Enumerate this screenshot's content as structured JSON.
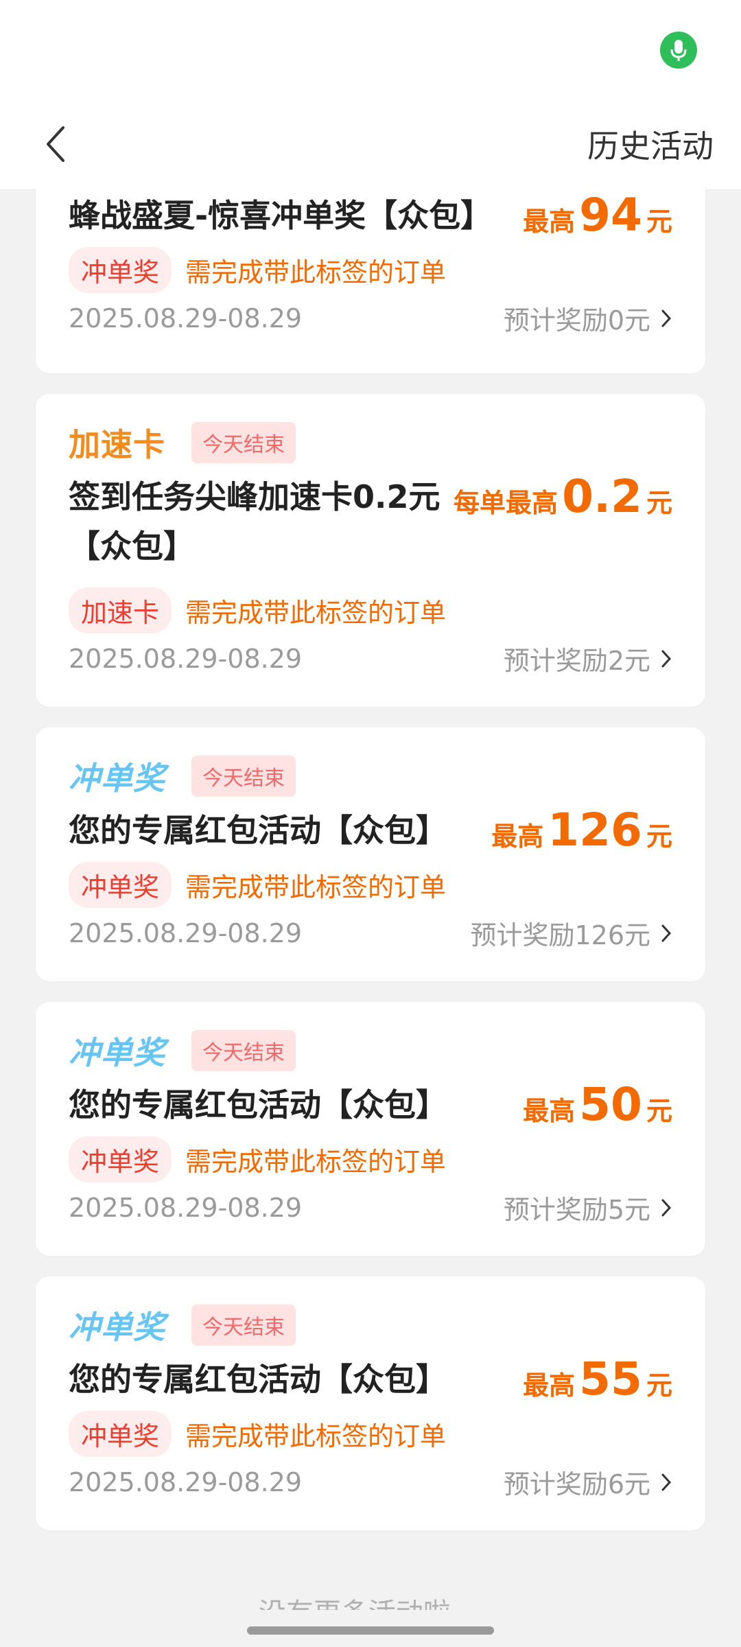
{
  "header": {
    "history_label": "历史活动"
  },
  "cards": [
    {
      "title": "蜂战盛夏-惊喜冲单奖【众包】",
      "reward_prefix": "最高",
      "reward_amount": "94",
      "reward_unit": "元",
      "tag": "冲单奖",
      "tag_desc": "需完成带此标签的订单",
      "date": "2025.08.29-08.29",
      "estimate": "预计奖励0元"
    },
    {
      "badge": "加速卡",
      "ends": "今天结束",
      "title_line1": "签到任务尖峰加速卡0.2元",
      "title_line2": "【众包】",
      "reward_prefix": "每单最高",
      "reward_amount": "0.2",
      "reward_unit": "元",
      "tag": "加速卡",
      "tag_desc": "需完成带此标签的订单",
      "date": "2025.08.29-08.29",
      "estimate": "预计奖励2元"
    },
    {
      "badge": "冲单奖",
      "ends": "今天结束",
      "title": "您的专属红包活动【众包】",
      "reward_prefix": "最高",
      "reward_amount": "126",
      "reward_unit": "元",
      "tag": "冲单奖",
      "tag_desc": "需完成带此标签的订单",
      "date": "2025.08.29-08.29",
      "estimate": "预计奖励126元"
    },
    {
      "badge": "冲单奖",
      "ends": "今天结束",
      "title": "您的专属红包活动【众包】",
      "reward_prefix": "最高",
      "reward_amount": "50",
      "reward_unit": "元",
      "tag": "冲单奖",
      "tag_desc": "需完成带此标签的订单",
      "date": "2025.08.29-08.29",
      "estimate": "预计奖励5元"
    },
    {
      "badge": "冲单奖",
      "ends": "今天结束",
      "title": "您的专属红包活动【众包】",
      "reward_prefix": "最高",
      "reward_amount": "55",
      "reward_unit": "元",
      "tag": "冲单奖",
      "tag_desc": "需完成带此标签的订单",
      "date": "2025.08.29-08.29",
      "estimate": "预计奖励6元"
    }
  ],
  "footer": {
    "text": "没有更多活动啦 ~"
  },
  "colors": {
    "accent_orange": "#f26a00",
    "tag_red": "#ee3c2e",
    "badge_blue": "#66c5f2",
    "status_green": "#2fbf5a"
  }
}
